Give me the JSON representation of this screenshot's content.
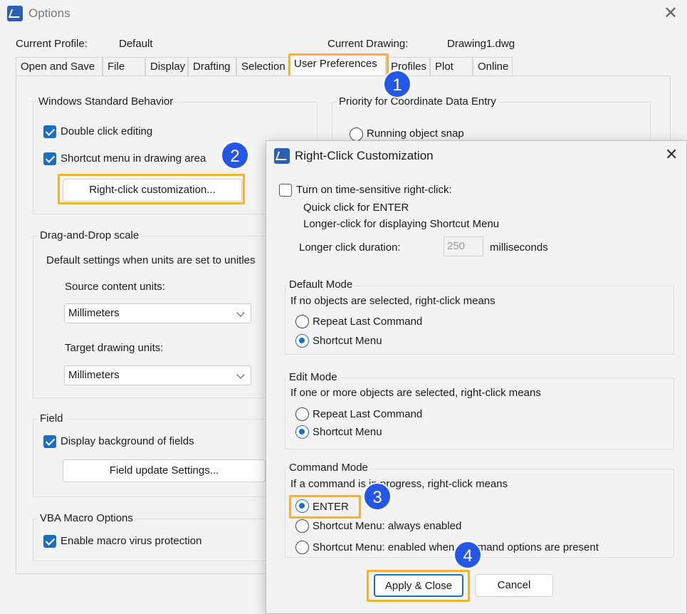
{
  "window": {
    "title": "Options"
  },
  "profile": {
    "label": "Current Profile:",
    "value": "Default"
  },
  "drawing": {
    "label": "Current Drawing:",
    "value": "Drawing1.dwg"
  },
  "tabs": [
    "Open and Save",
    "File",
    "Display",
    "Drafting",
    "Selection",
    "User Preferences",
    "Profiles",
    "Plot",
    "Online"
  ],
  "win_behavior": {
    "title": "Windows Standard Behavior",
    "double_click": "Double click editing",
    "shortcut_menu": "Shortcut menu in drawing area",
    "rc_button": "Right-click customization..."
  },
  "priority": {
    "title": "Priority for Coordinate Data Entry",
    "running_snap": "Running object snap"
  },
  "dnd": {
    "title": "Drag-and-Drop scale",
    "desc": "Default settings when units are set to unitles",
    "source_label": "Source content units:",
    "source_value": "Millimeters",
    "target_label": "Target drawing units:",
    "target_value": "Millimeters"
  },
  "field": {
    "title": "Field",
    "display_bg": "Display background of fields",
    "update_btn": "Field update Settings..."
  },
  "vba": {
    "title": "VBA Macro Options",
    "enable": "Enable macro virus protection"
  },
  "dialog": {
    "title": "Right-Click Customization",
    "time_sensitive": "Turn on time-sensitive right-click:",
    "quick": "Quick click for ENTER",
    "longer": "Longer-click for displaying Shortcut Menu",
    "duration_label": "Longer click duration:",
    "duration_value": "250",
    "duration_unit": "milliseconds",
    "default_mode": {
      "title": "Default Mode",
      "desc": "If no objects are selected, right-click means",
      "opt1": "Repeat Last Command",
      "opt2": "Shortcut Menu"
    },
    "edit_mode": {
      "title": "Edit Mode",
      "desc": "If one or more objects are selected, right-click means",
      "opt1": "Repeat Last Command",
      "opt2": "Shortcut Menu"
    },
    "command_mode": {
      "title": "Command Mode",
      "desc": "If a command is in progress, right-click means",
      "opt1": "ENTER",
      "opt2": "Shortcut Menu: always enabled",
      "opt3": "Shortcut Menu: enabled when command options are present"
    },
    "apply": "Apply & Close",
    "cancel": "Cancel"
  },
  "badges": [
    "1",
    "2",
    "3",
    "4"
  ],
  "colors": {
    "accent": "#1b6ec2",
    "highlight": "#f2b233",
    "badge": "#2457e6"
  }
}
